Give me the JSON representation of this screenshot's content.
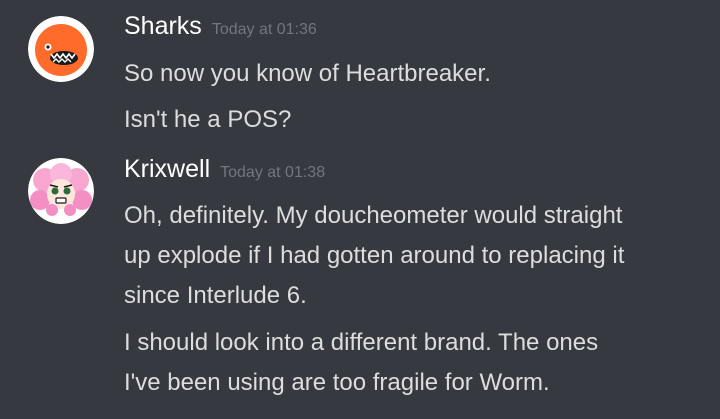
{
  "messages": [
    {
      "username": "Sharks",
      "timestamp": "Today at 01:36",
      "avatar_color": "#ff6b2b",
      "lines": [
        "So now you know of Heartbreaker.",
        "Isn't he a POS?"
      ]
    },
    {
      "username": "Krixwell",
      "timestamp": "Today at 01:38",
      "avatar_color": "#f7a6d0",
      "lines": [
        "Oh, definitely. My doucheometer would straight",
        "up explode if I had gotten around to replacing it",
        "since Interlude 6.",
        "I should look into a different brand. The ones",
        "I've been using are too fragile for Worm."
      ]
    }
  ]
}
